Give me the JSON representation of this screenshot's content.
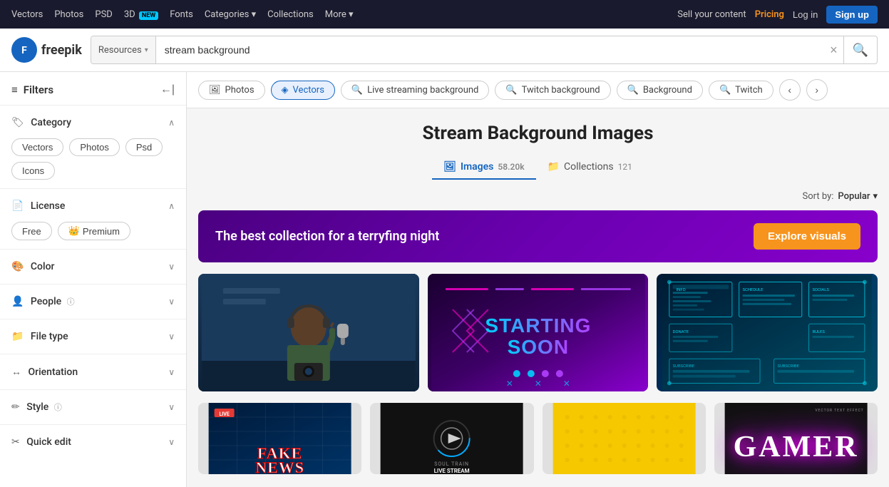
{
  "topnav": {
    "links": [
      {
        "label": "Vectors",
        "id": "nav-vectors"
      },
      {
        "label": "Photos",
        "id": "nav-photos"
      },
      {
        "label": "PSD",
        "id": "nav-psd"
      },
      {
        "label": "3D",
        "id": "nav-3d",
        "badge": "NEW"
      },
      {
        "label": "Fonts",
        "id": "nav-fonts"
      },
      {
        "label": "Categories",
        "id": "nav-categories"
      },
      {
        "label": "Collections",
        "id": "nav-collections"
      },
      {
        "label": "More",
        "id": "nav-more"
      }
    ],
    "right_links": [
      {
        "label": "Sell your content"
      },
      {
        "label": "Pricing"
      },
      {
        "label": "Log in"
      },
      {
        "label": "Sign up"
      }
    ],
    "sell_label": "Sell your content",
    "pricing_label": "Pricing",
    "login_label": "Log in",
    "signup_label": "Sign up"
  },
  "header": {
    "logo_text": "freepik",
    "search_placeholder": "stream background",
    "search_resource": "Resources",
    "clear_btn": "×"
  },
  "sidebar": {
    "title": "Filters",
    "sections": [
      {
        "id": "category",
        "label": "Category",
        "icon": "🏷",
        "expanded": true,
        "tags": [
          "Vectors",
          "Photos",
          "Psd",
          "Icons"
        ]
      },
      {
        "id": "license",
        "label": "License",
        "icon": "📄",
        "expanded": true,
        "tags": [
          "Free",
          "Premium"
        ]
      },
      {
        "id": "color",
        "label": "Color",
        "icon": "🎨",
        "expanded": false
      },
      {
        "id": "people",
        "label": "People",
        "icon": "👤",
        "expanded": false
      },
      {
        "id": "filetype",
        "label": "File type",
        "icon": "📁",
        "expanded": false
      },
      {
        "id": "orientation",
        "label": "Orientation",
        "icon": "↔",
        "expanded": false
      },
      {
        "id": "style",
        "label": "Style",
        "icon": "✏",
        "expanded": false
      },
      {
        "id": "quickedit",
        "label": "Quick edit",
        "icon": "✂",
        "expanded": false
      }
    ]
  },
  "chips": [
    {
      "label": "Photos",
      "icon": "🖼",
      "active": false
    },
    {
      "label": "Vectors",
      "icon": "◈",
      "active": true
    },
    {
      "label": "Live streaming background",
      "icon": "🔍",
      "active": false
    },
    {
      "label": "Twitch background",
      "icon": "🔍",
      "active": false
    },
    {
      "label": "Background",
      "icon": "🔍",
      "active": false
    },
    {
      "label": "Twitch",
      "icon": "🔍",
      "active": false
    }
  ],
  "page_title": "Stream Background Images",
  "tabs": [
    {
      "label": "Images",
      "count": "58.20k",
      "active": true,
      "icon": "🖼"
    },
    {
      "label": "Collections",
      "count": "121",
      "active": false,
      "icon": "📁"
    }
  ],
  "sort": {
    "label": "Sort by:",
    "value": "Popular"
  },
  "promo": {
    "text": "The best collection for a terryfing night",
    "btn_label": "Explore visuals"
  },
  "images": [
    {
      "id": "img1",
      "type": "streaming-person",
      "alt": "Streaming person with headphones"
    },
    {
      "id": "img2",
      "type": "starting-soon",
      "alt": "Starting soon neon background"
    },
    {
      "id": "img3",
      "type": "scifi-overlay",
      "alt": "Sci-fi stream overlay"
    }
  ],
  "images_row2": [
    {
      "id": "img4",
      "type": "fake-news",
      "alt": "Fake news stream background"
    },
    {
      "id": "img5",
      "type": "stream-info",
      "alt": "Stream info overlay"
    },
    {
      "id": "img6",
      "type": "dots-pattern",
      "alt": "Yellow dots pattern background"
    },
    {
      "id": "img7",
      "type": "gamer-text",
      "alt": "Gamer neon text effect"
    }
  ]
}
